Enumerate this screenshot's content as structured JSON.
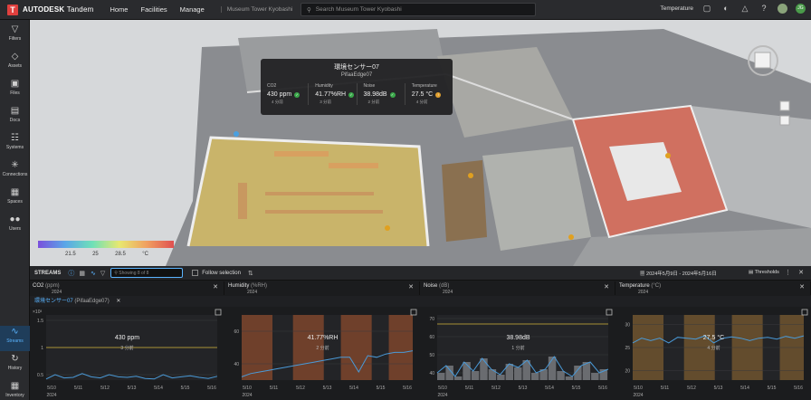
{
  "topbar": {
    "logo_letter": "T",
    "brand_a": "AUTODESK",
    "brand_b": "Tandem",
    "nav": [
      "Home",
      "Facilities",
      "Manage"
    ],
    "facility": "Museum Tower Kyobashi",
    "search_placeholder": "Search Museum Tower Kyobashi",
    "view_label": "Temperature",
    "user_initials": "JG"
  },
  "sidebar": {
    "items": [
      {
        "label": "Filters",
        "icon": "filter-icon"
      },
      {
        "label": "Assets",
        "icon": "tag-icon"
      },
      {
        "label": "Files",
        "icon": "folder-icon"
      },
      {
        "label": "Docs",
        "icon": "docs-icon"
      },
      {
        "label": "Systems",
        "icon": "systems-icon"
      },
      {
        "label": "Connections",
        "icon": "connections-icon"
      },
      {
        "label": "Spaces",
        "icon": "spaces-icon"
      },
      {
        "label": "Users",
        "icon": "users-icon"
      },
      {
        "label": "Streams",
        "icon": "streams-icon"
      },
      {
        "label": "History",
        "icon": "history-icon"
      },
      {
        "label": "Inventory",
        "icon": "inventory-icon"
      }
    ]
  },
  "sensor": {
    "name": "環境センサー07",
    "device": "PifaaEdge07",
    "metrics": [
      {
        "label": "CO2",
        "value": "430 ppm",
        "time": "4 分前",
        "status": "ok"
      },
      {
        "label": "Humidity",
        "value": "41.77%RH",
        "time": "3 分前",
        "status": "ok"
      },
      {
        "label": "Noise",
        "value": "38.98dB",
        "time": "2 分前",
        "status": "ok"
      },
      {
        "label": "Temperature",
        "value": "27.5 °C",
        "time": "4 分前",
        "status": "warn"
      }
    ]
  },
  "legend": {
    "ticks": [
      "21.5",
      "25",
      "28.5"
    ],
    "unit": "°C"
  },
  "streams": {
    "title": "STREAMS",
    "filter_placeholder": "Showing 8 of 8",
    "follow_label": "Follow selection",
    "date_range": "2024年5月9日 - 2024年5月16日",
    "thresholds_label": "Thresholds",
    "sensor_row": "環境センサー07",
    "sensor_row_device": "(PifaaEdge07)",
    "columns": [
      {
        "title": "CO2",
        "unit": "(ppm)",
        "year": "2024"
      },
      {
        "title": "Humidity",
        "unit": "(%RH)",
        "year": "2024"
      },
      {
        "title": "Noise",
        "unit": "(dB)",
        "year": "2024"
      },
      {
        "title": "Temperature",
        "unit": "(°C)",
        "year": "2024"
      }
    ]
  },
  "chart_data": [
    {
      "type": "line",
      "title": "CO2",
      "ylabel": "",
      "y_exponent": "×10³",
      "yticks": [
        0.5,
        1,
        1.5
      ],
      "ylim": [
        0.4,
        1.6
      ],
      "threshold": 1.0,
      "x": [
        "5/10",
        "5/11",
        "5/12",
        "5/13",
        "5/14",
        "5/15",
        "5/16"
      ],
      "year": "2024",
      "values": [
        0.42,
        0.5,
        0.44,
        0.45,
        0.52,
        0.46,
        0.44,
        0.5,
        0.46,
        0.45,
        0.47,
        0.43,
        0.42,
        0.5,
        0.44,
        0.46,
        0.48,
        0.45,
        0.43,
        0.47
      ],
      "current": "430 ppm",
      "current_time": "3 分前"
    },
    {
      "type": "line",
      "title": "Humidity",
      "yticks": [
        40,
        60
      ],
      "ylim": [
        30,
        70
      ],
      "x": [
        "5/10",
        "5/11",
        "5/12",
        "5/13",
        "5/14",
        "5/15",
        "5/16"
      ],
      "year": "2024",
      "values": [
        32,
        34,
        35,
        36,
        37,
        38,
        39,
        40,
        41,
        42,
        43,
        44,
        44,
        35,
        45,
        44,
        46,
        47,
        47,
        48
      ],
      "current": "41.77%RH",
      "current_time": "2 分前"
    },
    {
      "type": "line",
      "title": "Noise",
      "yticks": [
        40,
        50,
        60,
        70
      ],
      "ylim": [
        36,
        72
      ],
      "threshold": 67,
      "x": [
        "5/10",
        "5/11",
        "5/12",
        "5/13",
        "5/14",
        "5/15",
        "5/16"
      ],
      "year": "2024",
      "values": [
        40,
        44,
        38,
        46,
        41,
        48,
        42,
        39,
        45,
        43,
        47,
        40,
        42,
        49,
        41,
        38,
        44,
        46,
        40,
        42
      ],
      "current": "38.98dB",
      "current_time": "1 分前"
    },
    {
      "type": "line",
      "title": "Temperature",
      "yticks": [
        20,
        25,
        30
      ],
      "ylim": [
        18,
        32
      ],
      "x": [
        "5/10",
        "5/11",
        "5/12",
        "5/13",
        "5/14",
        "5/15",
        "5/16"
      ],
      "year": "2024",
      "values": [
        26,
        27,
        26.5,
        27,
        26,
        27.2,
        27,
        26.8,
        27.5,
        26,
        27,
        27.3,
        27,
        26.5,
        27,
        27.2,
        26.8,
        27.4,
        27,
        27.5
      ],
      "current": "27.5 °C",
      "current_time": "4 分前"
    }
  ],
  "colors": {
    "accent": "#5ab4ff",
    "threshold": "#d4b63a",
    "band": "#a0502e",
    "line": "#4a9ad8",
    "ok": "#3aa84a",
    "warn": "#e0a030"
  }
}
